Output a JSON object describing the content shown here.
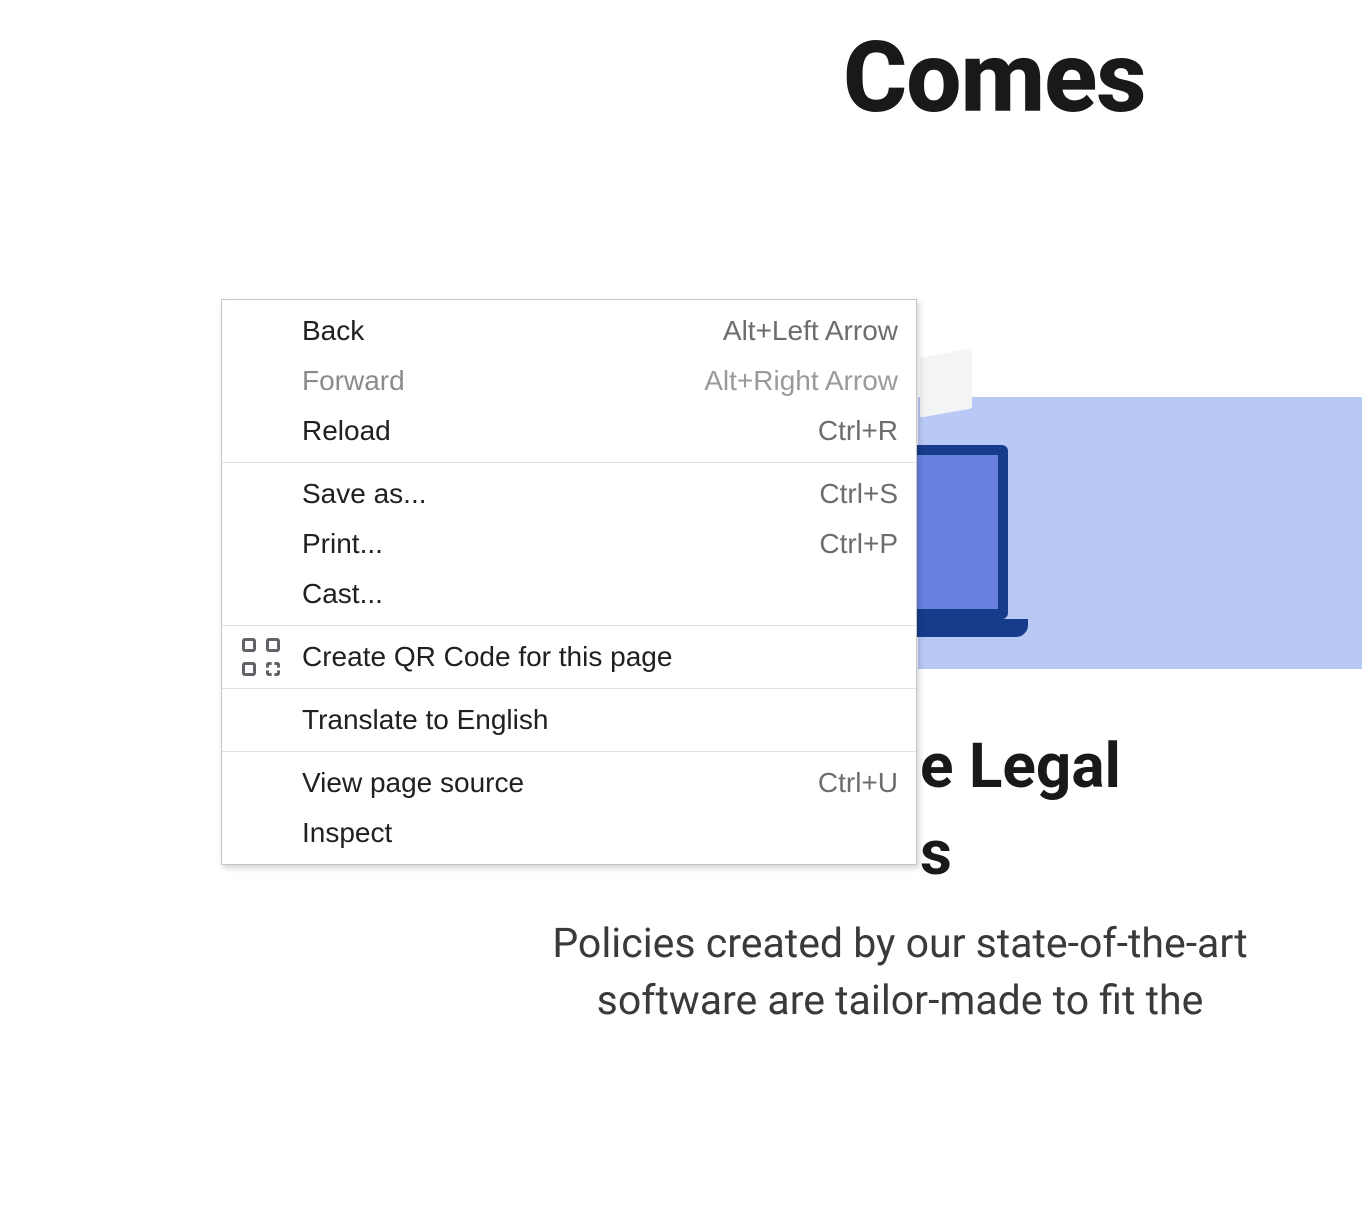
{
  "page": {
    "heading": "Comes",
    "section_title_line1": "e Legal",
    "section_title_line2": "s",
    "body": "Policies created by our state-of-the-art software are tailor-made to fit the"
  },
  "context_menu": {
    "groups": [
      [
        {
          "label": "Back",
          "shortcut": "Alt+Left Arrow",
          "icon": "",
          "disabled": false
        },
        {
          "label": "Forward",
          "shortcut": "Alt+Right Arrow",
          "icon": "",
          "disabled": true
        },
        {
          "label": "Reload",
          "shortcut": "Ctrl+R",
          "icon": "",
          "disabled": false
        }
      ],
      [
        {
          "label": "Save as...",
          "shortcut": "Ctrl+S",
          "icon": "",
          "disabled": false
        },
        {
          "label": "Print...",
          "shortcut": "Ctrl+P",
          "icon": "",
          "disabled": false
        },
        {
          "label": "Cast...",
          "shortcut": "",
          "icon": "",
          "disabled": false
        }
      ],
      [
        {
          "label": "Create QR Code for this page",
          "shortcut": "",
          "icon": "qr",
          "disabled": false
        }
      ],
      [
        {
          "label": "Translate to English",
          "shortcut": "",
          "icon": "",
          "disabled": false
        }
      ],
      [
        {
          "label": "View page source",
          "shortcut": "Ctrl+U",
          "icon": "",
          "disabled": false
        },
        {
          "label": "Inspect",
          "shortcut": "",
          "icon": "",
          "disabled": false
        }
      ]
    ]
  }
}
